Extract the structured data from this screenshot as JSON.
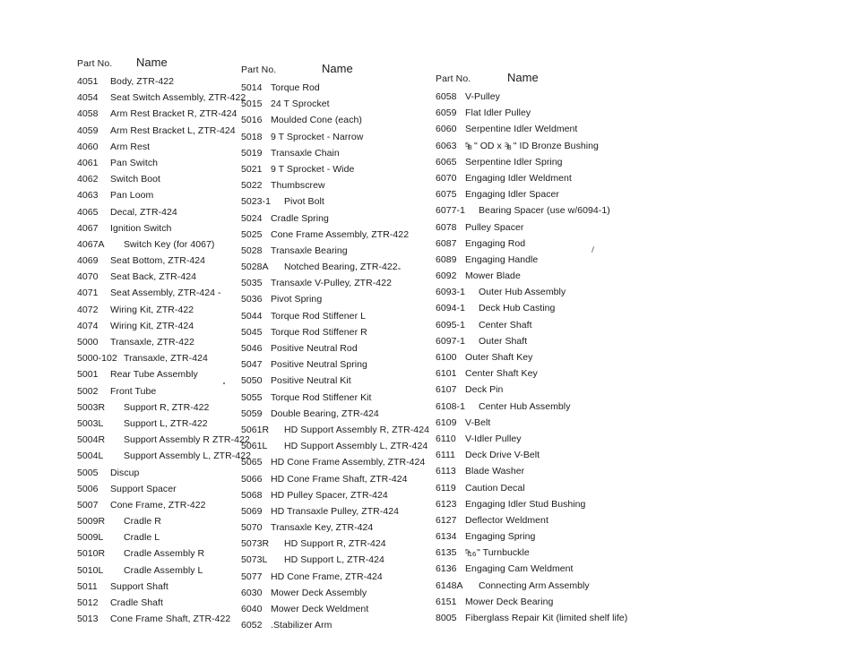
{
  "document": {
    "type": "parts-list",
    "headers": {
      "part_no": "Part No.",
      "name": "Name"
    }
  },
  "columns": [
    {
      "id": "column-1",
      "header_part_no": "Part No.",
      "header_name": "Name",
      "rows": [
        {
          "part_no": "4051",
          "name": "Body, ZTR-422"
        },
        {
          "part_no": "4054",
          "name": "Seat Switch Assembly, ZTR-422"
        },
        {
          "part_no": "4058",
          "name": "Arm Rest Bracket R, ZTR-424"
        },
        {
          "part_no": "4059",
          "name": "Arm Rest Bracket L, ZTR-424"
        },
        {
          "part_no": "4060",
          "name": "Arm Rest"
        },
        {
          "part_no": "4061",
          "name": "Pan Switch"
        },
        {
          "part_no": "4062",
          "name": "Switch Boot"
        },
        {
          "part_no": "4063",
          "name": "Pan Loom"
        },
        {
          "part_no": "4065",
          "name": "Decal, ZTR-424"
        },
        {
          "part_no": "4067",
          "name": "Ignition Switch"
        },
        {
          "part_no": "4067A",
          "name": "Switch Key (for 4067)",
          "wide": true
        },
        {
          "part_no": "4069",
          "name": "Seat Bottom, ZTR-424"
        },
        {
          "part_no": "4070",
          "name": "Seat Back, ZTR-424"
        },
        {
          "part_no": "4071",
          "name": "Seat Assembly, ZTR-424 -"
        },
        {
          "part_no": "4072",
          "name": "Wiring Kit, ZTR-422"
        },
        {
          "part_no": "4074",
          "name": "Wiring Kit, ZTR-424"
        },
        {
          "part_no": "5000",
          "name": "Transaxle, ZTR-422"
        },
        {
          "part_no": "5000-102",
          "name": "Transaxle, ZTR-424",
          "wide": true
        },
        {
          "part_no": "5001",
          "name": "Rear Tube Assembly"
        },
        {
          "part_no": "5002",
          "name": "Front Tube"
        },
        {
          "part_no": "5003R",
          "name": "Support R, ZTR-422",
          "wide": true
        },
        {
          "part_no": "5003L",
          "name": "Support L, ZTR-422",
          "wide": true
        },
        {
          "part_no": "5004R",
          "name": "Support Assembly R ZTR-422",
          "wide": true
        },
        {
          "part_no": "5004L",
          "name": "Support Assembly L, ZTR-422",
          "wide": true
        },
        {
          "part_no": "5005",
          "name": "Discup"
        },
        {
          "part_no": "5006",
          "name": "Support Spacer"
        },
        {
          "part_no": "5007",
          "name": "Cone Frame, ZTR-422"
        },
        {
          "part_no": "5009R",
          "name": "Cradle R",
          "wide": true
        },
        {
          "part_no": "5009L",
          "name": "Cradle L",
          "wide": true
        },
        {
          "part_no": "5010R",
          "name": "Cradle Assembly R",
          "wide": true
        },
        {
          "part_no": "5010L",
          "name": "Cradle Assembly L",
          "wide": true
        },
        {
          "part_no": "5011",
          "name": "Support Shaft"
        },
        {
          "part_no": "5012",
          "name": "Cradle Shaft"
        },
        {
          "part_no": "5013",
          "name": "Cone Frame Shaft, ZTR-422"
        }
      ]
    },
    {
      "id": "column-2",
      "header_part_no": "Part No.",
      "header_name": "Name",
      "rows": [
        {
          "part_no": "5014",
          "name": "Torque Rod"
        },
        {
          "part_no": "5015",
          "name": "24 T Sprocket"
        },
        {
          "part_no": "5016",
          "name": "Moulded Cone (each)"
        },
        {
          "part_no": "5018",
          "name": "9 T Sprocket - Narrow"
        },
        {
          "part_no": "5019",
          "name": "Transaxle Chain"
        },
        {
          "part_no": "5021",
          "name": "9 T Sprocket - Wide"
        },
        {
          "part_no": "5022",
          "name": "Thumbscrew"
        },
        {
          "part_no": "5023-1",
          "name": "Pivot Bolt",
          "wide": true
        },
        {
          "part_no": "5024",
          "name": "Cradle Spring"
        },
        {
          "part_no": "5025",
          "name": "Cone Frame Assembly, ZTR-422"
        },
        {
          "part_no": "5028",
          "name": "Transaxle Bearing"
        },
        {
          "part_no": "5028A",
          "name": "Notched Bearing, ZTR-422",
          "wide": true
        },
        {
          "part_no": "5035",
          "name": "Transaxle V-Pulley, ZTR-422"
        },
        {
          "part_no": "5036",
          "name": "Pivot Spring"
        },
        {
          "part_no": "5044",
          "name": "Torque Rod Stiffener L"
        },
        {
          "part_no": "5045",
          "name": "Torque Rod Stiffener R"
        },
        {
          "part_no": "5046",
          "name": "Positive Neutral Rod"
        },
        {
          "part_no": "5047",
          "name": "Positive Neutral Spring"
        },
        {
          "part_no": "5050",
          "name": "Positive Neutral Kit"
        },
        {
          "part_no": "5055",
          "name": "Torque Rod Stiffener Kit"
        },
        {
          "part_no": "5059",
          "name": "Double Bearing, ZTR-424"
        },
        {
          "part_no": "5061R",
          "name": "HD Support Assembly R, ZTR-424",
          "wide": true
        },
        {
          "part_no": "5061L",
          "name": "HD Support Assembly L, ZTR-424",
          "wide": true
        },
        {
          "part_no": "5065",
          "name": "HD Cone Frame Assembly, ZTR-424"
        },
        {
          "part_no": "5066",
          "name": "HD Cone Frame Shaft, ZTR-424"
        },
        {
          "part_no": "5068",
          "name": "HD Pulley Spacer, ZTR-424"
        },
        {
          "part_no": "5069",
          "name": "HD Transaxle Pulley, ZTR-424"
        },
        {
          "part_no": "5070",
          "name": "Transaxle Key, ZTR-424"
        },
        {
          "part_no": "5073R",
          "name": "HD Support R, ZTR-424",
          "wide": true
        },
        {
          "part_no": "5073L",
          "name": "HD Support L, ZTR-424",
          "wide": true
        },
        {
          "part_no": "5077",
          "name": "HD Cone Frame, ZTR-424"
        },
        {
          "part_no": "6030",
          "name": "Mower Deck Assembly"
        },
        {
          "part_no": "6040",
          "name": "Mower Deck Weldment"
        },
        {
          "part_no": "6052",
          "name": ".Stabilizer Arm"
        }
      ]
    },
    {
      "id": "column-3",
      "header_part_no": "Part No.",
      "header_name": "Name",
      "rows": [
        {
          "part_no": "6058",
          "name": "V-Pulley"
        },
        {
          "part_no": "6059",
          "name": "Flat Idler Pulley"
        },
        {
          "part_no": "6060",
          "name": "Serpentine Idler Weldment"
        },
        {
          "part_no": "6063",
          "name": "5/8\" OD x 3/8\" ID Bronze Bushing",
          "rich": [
            {
              "frac": {
                "num": "5",
                "den": "8"
              }
            },
            {
              "text": "\" OD x "
            },
            {
              "frac": {
                "num": "3",
                "den": "8"
              }
            },
            {
              "text": "\" ID Bronze Bushing"
            }
          ]
        },
        {
          "part_no": "6065",
          "name": "Serpentine Idler Spring"
        },
        {
          "part_no": "6070",
          "name": "Engaging Idler Weldment"
        },
        {
          "part_no": "6075",
          "name": "Engaging Idler Spacer"
        },
        {
          "part_no": "6077-1",
          "name": "Bearing Spacer (use w/6094-1)",
          "wide": true
        },
        {
          "part_no": "6078",
          "name": "Pulley Spacer"
        },
        {
          "part_no": "6087",
          "name": "Engaging Rod"
        },
        {
          "part_no": "6089",
          "name": "Engaging Handle"
        },
        {
          "part_no": "6092",
          "name": "Mower Blade"
        },
        {
          "part_no": "6093-1",
          "name": "Outer Hub Assembly",
          "wide": true
        },
        {
          "part_no": "6094-1",
          "name": "Deck Hub Casting",
          "wide": true
        },
        {
          "part_no": "6095-1",
          "name": "Center Shaft",
          "wide": true
        },
        {
          "part_no": "6097-1",
          "name": "Outer Shaft",
          "wide": true
        },
        {
          "part_no": "6100",
          "name": "Outer Shaft Key"
        },
        {
          "part_no": "6101",
          "name": "Center Shaft Key"
        },
        {
          "part_no": "6107",
          "name": "Deck Pin"
        },
        {
          "part_no": "6108-1",
          "name": "Center Hub Assembly",
          "wide": true
        },
        {
          "part_no": "6109",
          "name": "V-Belt"
        },
        {
          "part_no": "6110",
          "name": "V-Idler Pulley"
        },
        {
          "part_no": "6111",
          "name": "Deck Drive V-Belt"
        },
        {
          "part_no": "6113",
          "name": "Blade Washer"
        },
        {
          "part_no": "6119",
          "name": "Caution Decal"
        },
        {
          "part_no": "6123",
          "name": "Engaging Idler Stud Bushing"
        },
        {
          "part_no": "6127",
          "name": "Deflector Weldment"
        },
        {
          "part_no": "6134",
          "name": "Engaging Spring"
        },
        {
          "part_no": "6135",
          "name": "5/16\" Turnbuckle",
          "rich": [
            {
              "frac": {
                "num": "5",
                "den": "16",
                "wide": true
              }
            },
            {
              "text": "\" Turnbuckle"
            }
          ]
        },
        {
          "part_no": "6136",
          "name": "Engaging Cam Weldment"
        },
        {
          "part_no": "6148A",
          "name": "Connecting Arm Assembly",
          "wide": true
        },
        {
          "part_no": "6151",
          "name": "Mower Deck Bearing"
        },
        {
          "part_no": "8005",
          "name": "Fiberglass Repair Kit (limited shelf life)"
        }
      ]
    }
  ]
}
